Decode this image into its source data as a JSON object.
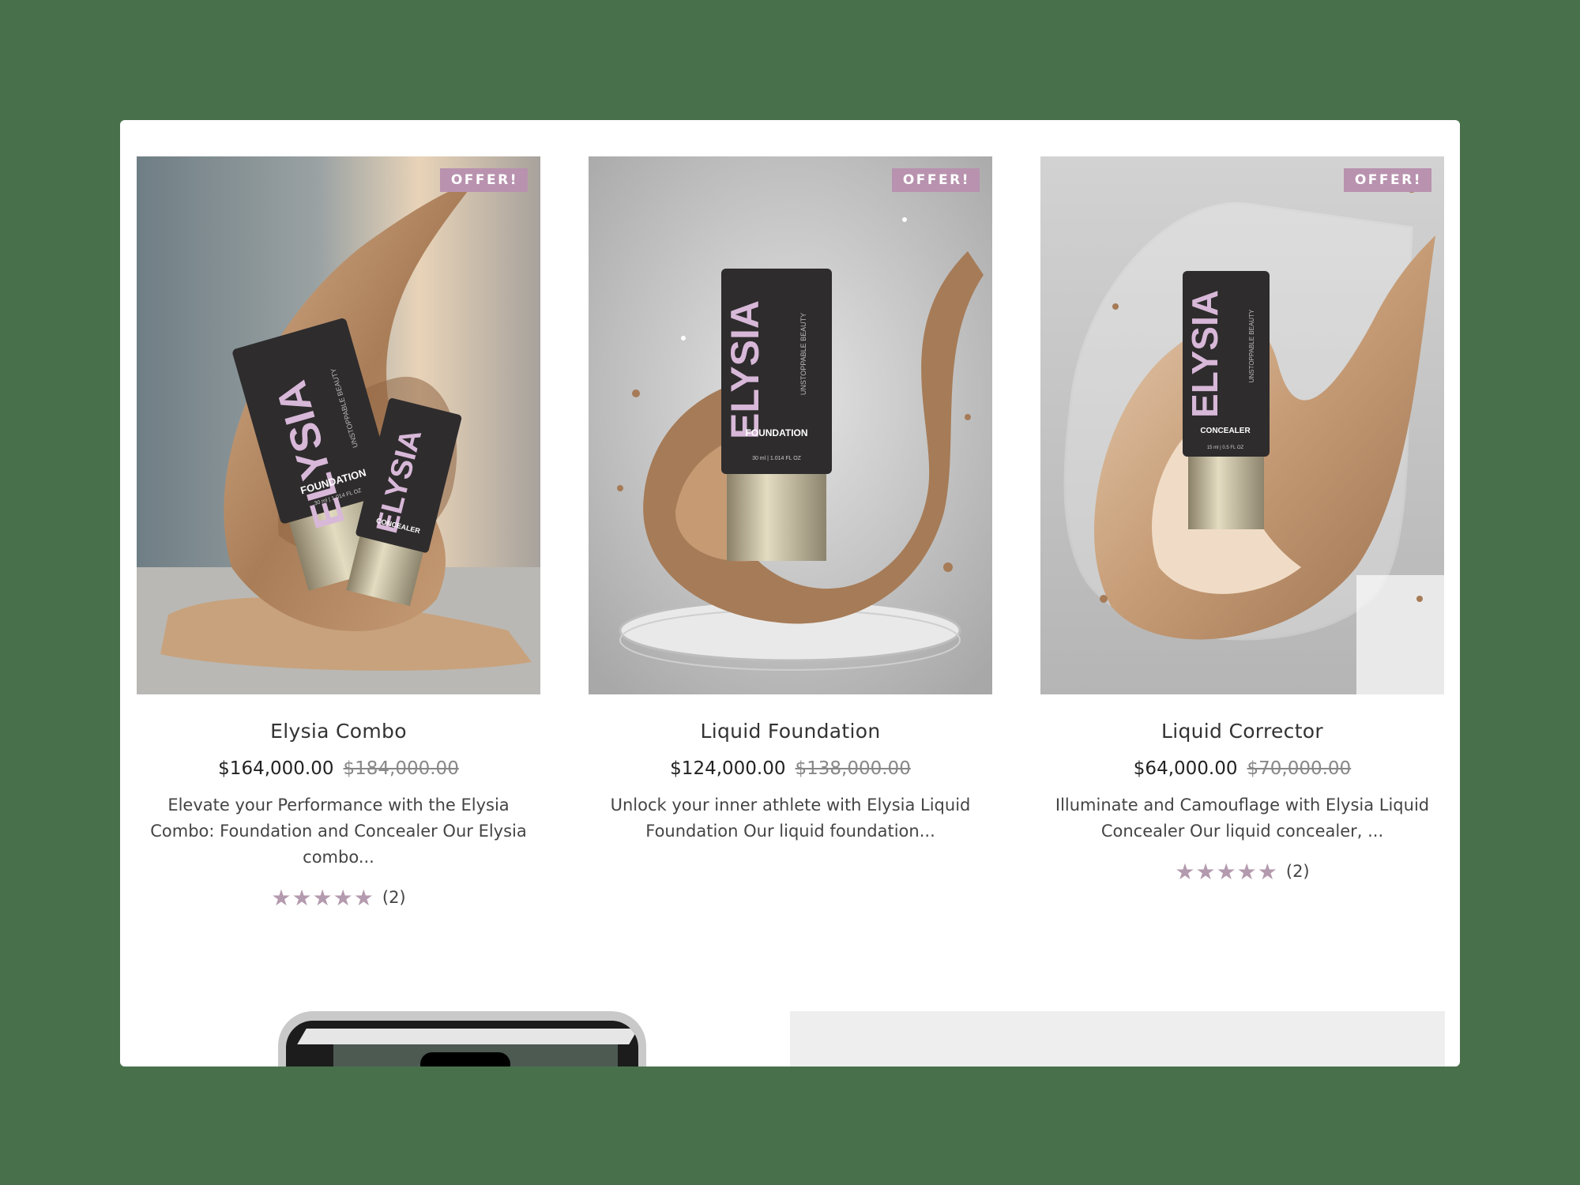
{
  "products": [
    {
      "badge": "OFFER!",
      "title": "Elysia Combo",
      "price": "$164,000.00",
      "compare_price": "$184,000.00",
      "description": "Elevate your Performance with the Elysia Combo: Foundation and Concealer Our Elysia combo...",
      "stars": "★★★★★",
      "review_count": "(2)",
      "rating": 5,
      "image_alt": "Elysia foundation and concealer tubes in a swirl of liquid foundation"
    },
    {
      "badge": "OFFER!",
      "title": "Liquid Foundation",
      "price": "$124,000.00",
      "compare_price": "$138,000.00",
      "description": "Unlock your inner athlete with Elysia Liquid Foundation Our liquid foundation...",
      "stars": "",
      "review_count": "",
      "rating": null,
      "image_alt": "Elysia foundation tube with splashing foundation on a glass pedestal"
    },
    {
      "badge": "OFFER!",
      "title": "Liquid Corrector",
      "price": "$64,000.00",
      "compare_price": "$70,000.00",
      "description": "Illuminate and Camouflage with Elysia Liquid Concealer Our liquid concealer, ...",
      "stars": "★★★★★",
      "review_count": "(2)",
      "rating": 5,
      "image_alt": "Elysia concealer tube with a wave of concealer and clear glass"
    }
  ],
  "product_art": {
    "brand": "ELYSIA",
    "tagline": "UNSTOPPABLE BEAUTY",
    "foundation_label": "FOUNDATION",
    "concealer_label": "CONCEALER",
    "volume_30": "30 ml | 1.014 FL OZ",
    "volume_15": "15 ml | 0.5 FL OZ"
  },
  "colors": {
    "badge": "#b892ae",
    "stars": "#b49aae",
    "background": "#48714b",
    "brand_text": "#d8b8d8"
  }
}
